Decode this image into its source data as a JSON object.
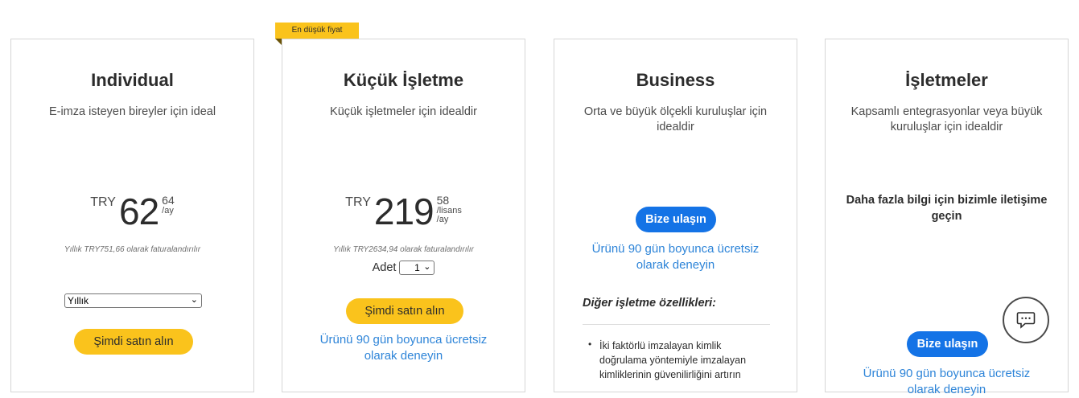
{
  "ribbon": {
    "label": "En düşük fiyat"
  },
  "cards": [
    {
      "title": "Individual",
      "subtitle": "E-imza isteyen bireyler için ideal",
      "price": {
        "currency": "TRY",
        "whole": "62",
        "cents": "64",
        "unit": "/ay"
      },
      "billed": "Yıllık TRY751,66 olarak faturalandırılır",
      "plan_select": "Yıllık",
      "buy_label": "Şimdi satın alın"
    },
    {
      "title": "Küçük İşletme",
      "subtitle": "Küçük işletmeler için idealdir",
      "price": {
        "currency": "TRY",
        "whole": "219",
        "cents": "58",
        "unit_line1": "/lisans",
        "unit_line2": "/ay"
      },
      "billed": "Yıllık TRY2634,94 olarak faturalandırılır",
      "quantity_label": "Adet",
      "quantity_value": "1",
      "buy_label": "Şimdi satın alın",
      "trial_link": "Ürünü 90 gün boyunca ücretsiz olarak deneyin"
    },
    {
      "title": "Business",
      "subtitle": "Orta ve büyük ölçekli kuruluşlar için idealdir",
      "contact_label": "Bize ulaşın",
      "trial_link": "Ürünü 90 gün boyunca ücretsiz olarak deneyin",
      "features_title": "Diğer işletme özellikleri:",
      "features": [
        "İki faktörlü imzalayan kimlik doğrulama yöntemiyle imzalayan kimliklerinin güvenilirliğini artırın"
      ]
    },
    {
      "title": "İşletmeler",
      "subtitle": "Kapsamlı entegrasyonlar veya büyük kuruluşlar için idealdir",
      "contact_text": "Daha fazla bilgi için bizimle iletişime geçin",
      "contact_label": "Bize ulaşın",
      "trial_link": "Ürünü 90 gün boyunca ücretsiz olarak deneyin"
    }
  ],
  "chat": {
    "icon": "chat-bubble-icon"
  }
}
